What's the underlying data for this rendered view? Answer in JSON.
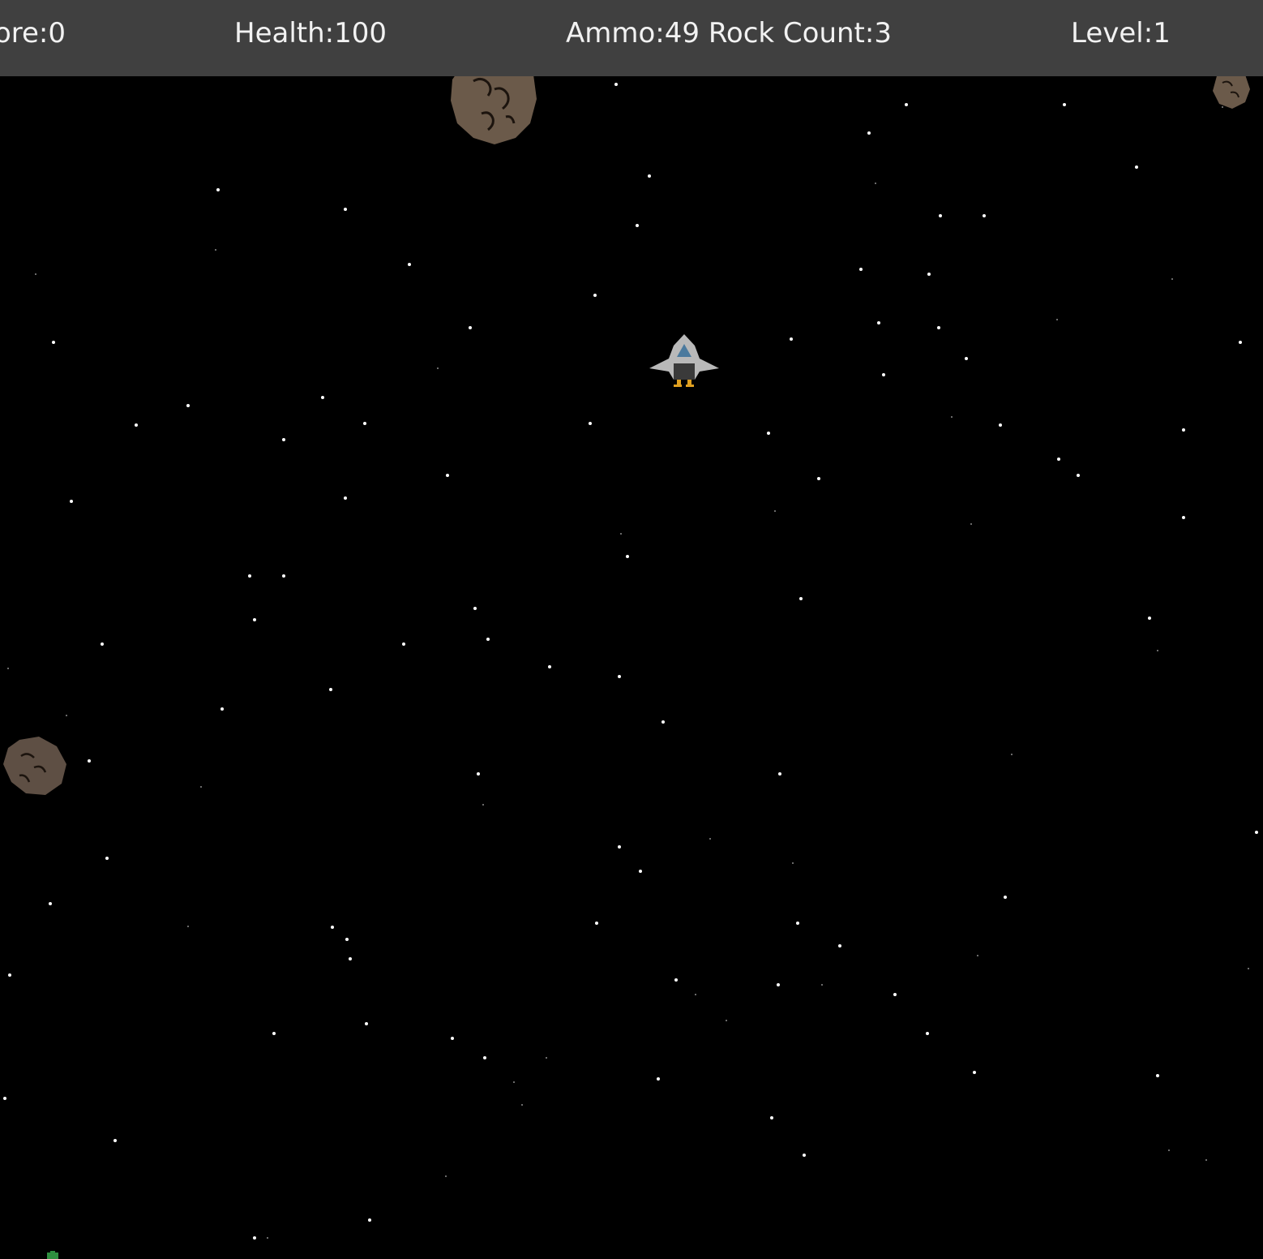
{
  "hud": {
    "score": "ore:0",
    "health": "Health:100",
    "ammo_rocks": "Ammo:49 Rock Count:3",
    "level": "Level:1"
  },
  "colors": {
    "background": "#000000",
    "hud_bar": "#404040",
    "hud_text": "#f2f2f2",
    "rock": "#6b5a4a",
    "ship_hull": "#b9b9b9",
    "cockpit": "#4b7a9e",
    "thruster": "#e0a020",
    "pickup": "#2f8f3f",
    "star": "#ffffff"
  },
  "sprites": [
    "asteroid-icon",
    "spaceship-icon",
    "pickup-icon"
  ]
}
